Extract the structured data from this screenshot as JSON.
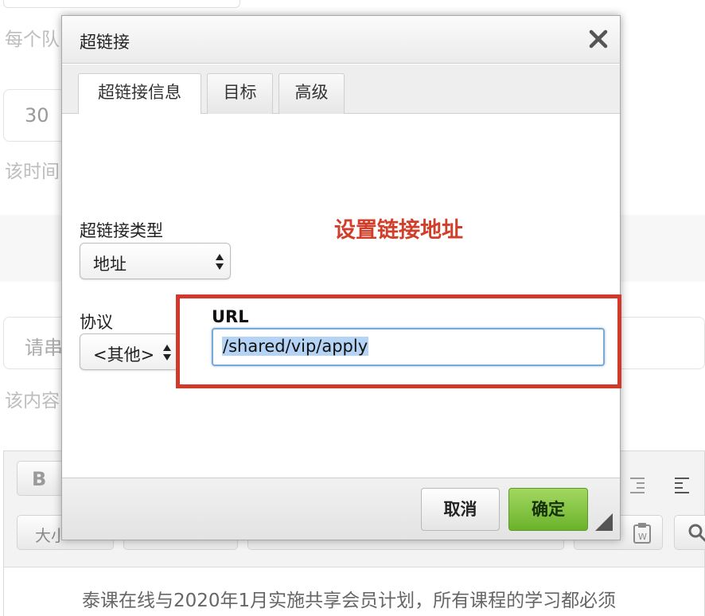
{
  "background": {
    "hint_1": "每个队",
    "number_value": "30",
    "hint_2": "该时间",
    "text_placeholder": "请串",
    "hint_3": "该内容",
    "toolbar": {
      "bold_label": "B",
      "size_label": "大小"
    },
    "content_text": "泰课在线与2020年1月实施共享会员计划，所有课程的学习都必须"
  },
  "dialog": {
    "title": "超链接",
    "tabs": [
      "超链接信息",
      "目标",
      "高级"
    ],
    "active_tab": 0,
    "link_type_label": "超链接类型",
    "link_type_value": "地址",
    "protocol_label": "协议",
    "protocol_value": "<其他>",
    "url_label": "URL",
    "url_value": "/shared/vip/apply",
    "annotation": "设置链接地址",
    "annotation_color": "#d13f2b",
    "highlight_color": "#d13a2a",
    "cancel_label": "取消",
    "ok_label": "确定",
    "ok_color": "#6bb22b",
    "icons": [
      "close-icon",
      "select-updown-icon",
      "resize-handle-icon"
    ]
  }
}
